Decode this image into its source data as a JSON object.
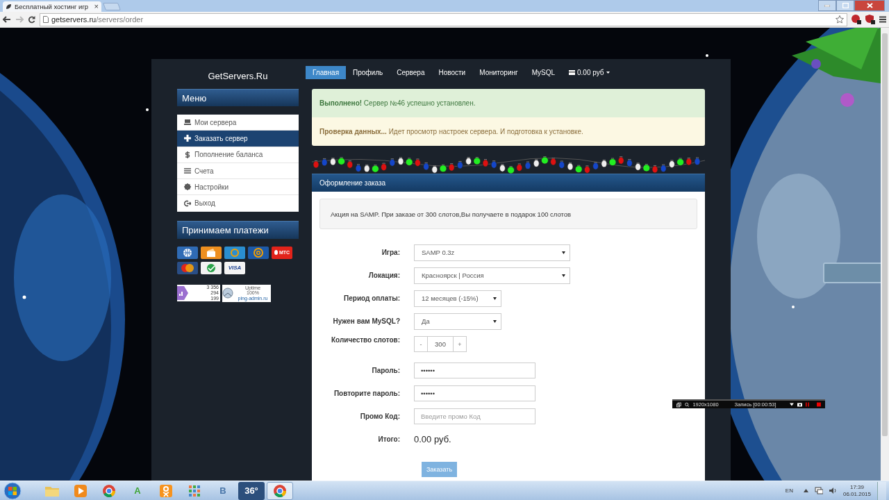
{
  "browser": {
    "tab_title": "Бесплатный хостинг игр",
    "tab_close": "×",
    "url_host": "getservers.ru",
    "url_path": "/servers/order"
  },
  "site": {
    "logo": "GetServers.Ru",
    "nav": [
      {
        "label": "Главная",
        "selected": true
      },
      {
        "label": "Профиль",
        "selected": false
      },
      {
        "label": "Сервера",
        "selected": false
      },
      {
        "label": "Новости",
        "selected": false
      },
      {
        "label": "Мониторинг",
        "selected": false
      },
      {
        "label": "MySQL",
        "selected": false
      }
    ],
    "balance": "0.00 руб"
  },
  "sidebar": {
    "menu_title": "Меню",
    "items": [
      {
        "label": "Мои сервера",
        "kind": "server",
        "selected": false
      },
      {
        "label": "Заказать сервер",
        "kind": "plus",
        "selected": true
      },
      {
        "label": "Пополнение баланса",
        "kind": "dollar",
        "selected": false
      },
      {
        "label": "Счета",
        "kind": "list",
        "selected": false
      },
      {
        "label": "Настройки",
        "kind": "gear",
        "selected": false
      },
      {
        "label": "Выход",
        "kind": "exit",
        "selected": false
      }
    ],
    "payments_title": "Принимаем платежи",
    "payments": [
      {
        "kind": "globe"
      },
      {
        "kind": "wallet"
      },
      {
        "kind": "ring"
      },
      {
        "kind": "at"
      },
      {
        "kind": "mts",
        "label": "МТС"
      },
      {
        "kind": "circles"
      },
      {
        "kind": "swirl"
      },
      {
        "kind": "visa",
        "label": "VISA"
      }
    ],
    "counter": [
      "3 356",
      "294",
      "199"
    ],
    "uptime": [
      "Uptime",
      "100%",
      "ping-admin.ru"
    ]
  },
  "alerts": [
    {
      "kind": "success",
      "text": "**Выполнено!** Сервер №46 успешно установлен."
    },
    {
      "kind": "warning",
      "text": "**Проверка данных...** Идет просмотр настроек сервера. И подготовка к установке."
    }
  ],
  "order": {
    "title": "Оформление заказа",
    "promo": "Акция на SAMP. При заказе от 300 слотов,Вы получаете в подарок 100 слотов",
    "fields": [
      {
        "label": "Игра:",
        "kind": "select",
        "value": "SAMP 0.3z"
      },
      {
        "label": "Локация:",
        "kind": "select",
        "value": "Красноярск | Россия"
      },
      {
        "label": "Период оплаты:",
        "kind": "select",
        "value": "12 месяцев (-15%)"
      },
      {
        "label": "Нужен вам MySQL?",
        "kind": "select",
        "value": "Да"
      },
      {
        "label": "Количество слотов:",
        "kind": "stepper",
        "minus": "-",
        "value": "300",
        "plus": "+"
      },
      {
        "label": "Пароль:",
        "kind": "password",
        "value": "••••••"
      },
      {
        "label": "Повторите пароль:",
        "kind": "password",
        "value": "••••••"
      },
      {
        "label": "Промо Код:",
        "kind": "text",
        "placeholder": "Введите промо Код"
      },
      {
        "label": "Итого:",
        "kind": "total",
        "value": "0.00 руб."
      }
    ],
    "submit": "Заказать"
  },
  "recorder": {
    "resolution": "1920x1080",
    "status": "Запись [00:00:53]"
  },
  "taskbar": {
    "items": [
      {
        "kind": "folder",
        "selected": false
      },
      {
        "kind": "media",
        "selected": false
      },
      {
        "kind": "chrome",
        "selected": false
      },
      {
        "kind": "letter",
        "label": "A",
        "color": "#3fa535",
        "selected": false
      },
      {
        "kind": "ok",
        "selected": false
      },
      {
        "kind": "grid",
        "selected": false
      },
      {
        "kind": "letter",
        "label": "В",
        "color": "#4a76a8",
        "selected": false
      },
      {
        "kind": "text",
        "label": "36°",
        "selected": false
      },
      {
        "kind": "chrome",
        "selected": true
      }
    ],
    "lang": "EN",
    "time": "17:39",
    "date": "06.01.2015"
  }
}
